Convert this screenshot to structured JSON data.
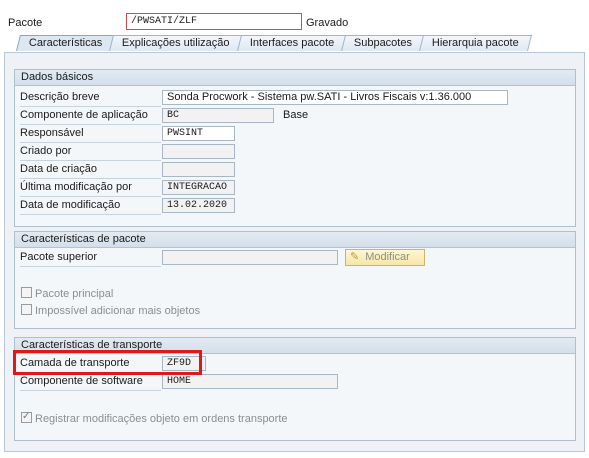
{
  "header": {
    "package_label": "Pacote",
    "package_value": "/PWSATI/ZLF",
    "status": "Gravado"
  },
  "tabs": [
    {
      "label": "Características",
      "active": true
    },
    {
      "label": "Explicações utilização",
      "active": false
    },
    {
      "label": "Interfaces pacote",
      "active": false
    },
    {
      "label": "Subpacotes",
      "active": false
    },
    {
      "label": "Hierarquia pacote",
      "active": false
    }
  ],
  "basic": {
    "title": "Dados básicos",
    "description_label": "Descrição breve",
    "description_value": "Sonda Procwork - Sistema pw.SATI - Livros Fiscais v:1.36.000",
    "app_component_label": "Componente de aplicação",
    "app_component_value": "BC",
    "app_component_text": "Base",
    "responsible_label": "Responsável",
    "responsible_value": "PWSINT",
    "created_by_label": "Criado por",
    "created_by_value": "",
    "created_on_label": "Data de criação",
    "created_on_value": "",
    "last_changed_by_label": "Última modificação por",
    "last_changed_by_value": "INTEGRACAO",
    "changed_on_label": "Data de modificação",
    "changed_on_value": "13.02.2020"
  },
  "package_props": {
    "title": "Características de pacote",
    "super_package_label": "Pacote superior",
    "super_package_value": "",
    "modify_button": "Modificar",
    "main_package_label": "Pacote principal",
    "main_package_checked": false,
    "no_more_objects_label": "Impossível adicionar mais objetos",
    "no_more_objects_checked": false
  },
  "transport": {
    "title": "Características de transporte",
    "layer_label": "Camada de transporte",
    "layer_value": "ZF9D",
    "software_component_label": "Componente de software",
    "software_component_value": "HOME",
    "record_changes_label": "Registrar modificações objeto em ordens transporte",
    "record_changes_checked": true
  },
  "colors": {
    "highlight": "#e01818",
    "panel": "#eef2f6",
    "group_header": "#d3dfeb"
  }
}
